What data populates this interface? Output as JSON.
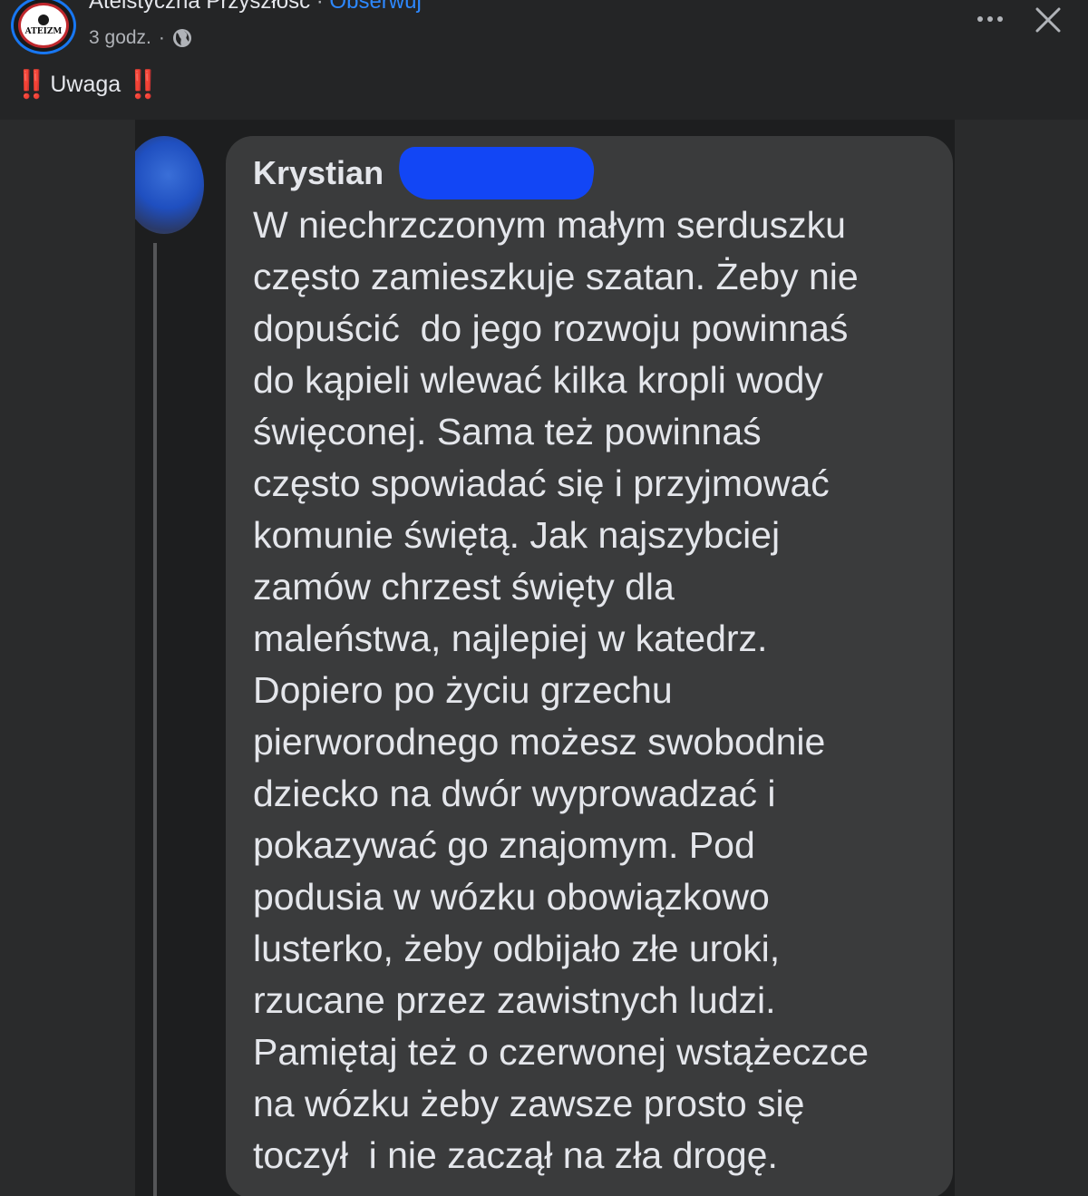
{
  "header": {
    "page_name": "Ateistyczna Przyszłośc",
    "separator": "·",
    "follow_label": "Obserwuj",
    "time_label": "3 godz.",
    "time_separator": "·",
    "privacy_icon": "globe-icon",
    "more_icon": "more-options-icon",
    "close_icon": "close-icon",
    "avatar_logo_text": "ATEIZM"
  },
  "post": {
    "emoji_left": "‼️",
    "text": "Uwaga",
    "emoji_right": "‼️"
  },
  "screenshot": {
    "commenter_name": "Krystian",
    "comment_lines": [
      "W niechrzczonym małym serduszku",
      "często zamieszkuje szatan. Żeby nie",
      "dopuścić  do jego rozwoju powinnaś",
      "do kąpieli wlewać kilka kropli wody",
      "święconej. Sama też powinnaś",
      "często spowiadać się i przyjmować",
      "komunie świętą. Jak najszybciej",
      "zamów chrzest święty dla",
      "maleństwa, najlepiej w katedrz.",
      "Dopiero po życiu grzechu",
      "pierworodnego możesz swobodnie",
      "dziecko na dwór wyprowadzać i",
      "pokazywać go znajomym. Pod",
      "podusia w wózku obowiązkowo",
      "lusterko, żeby odbijało złe uroki,",
      "rzucane przez zawistnych ludzi.",
      "Pamiętaj też o czerwonej wstążeczce",
      "na wózku żeby zawsze prosto się",
      "toczył  i nie zaczął na zła drogę."
    ]
  },
  "colors": {
    "background": "#242526",
    "text_primary": "#e4e6eb",
    "text_secondary": "#b0b3b8",
    "link": "#2d88ff",
    "bubble": "#3a3b3c",
    "redaction": "#1246f5"
  }
}
